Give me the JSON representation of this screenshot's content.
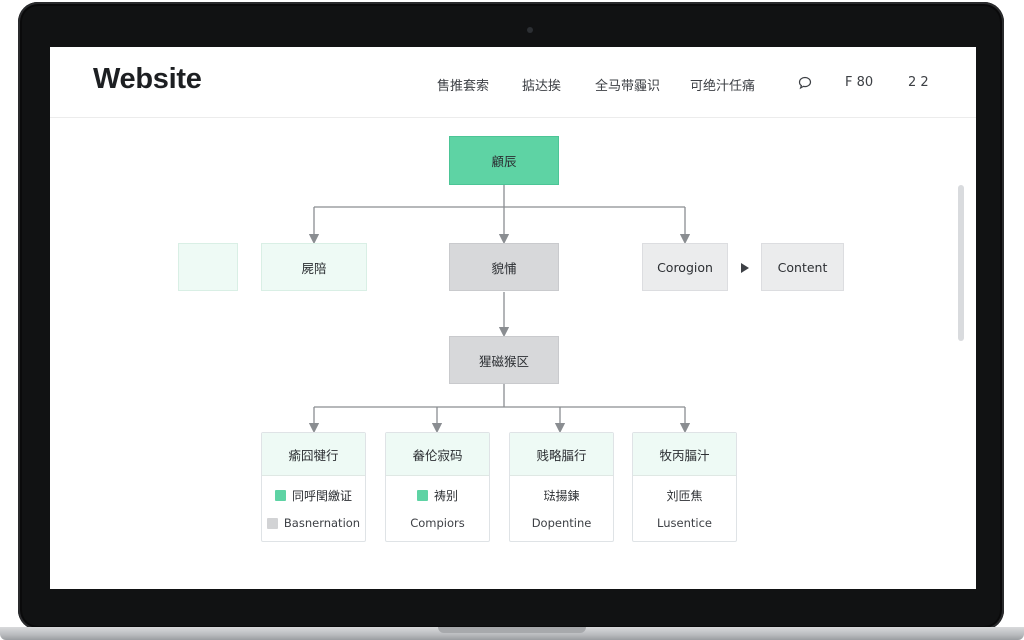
{
  "header": {
    "brand": "Website",
    "nav": [
      "售推套索",
      "掂达挨",
      "全马带霾识",
      "可绝汁任痛"
    ],
    "chat_icon": "speech-bubble-icon",
    "right_a": "F  80",
    "right_b": "2  2"
  },
  "diagram": {
    "root": "顧辰",
    "level1": {
      "mint_blank": "",
      "left": "屍陪",
      "center": "貌悑",
      "right": "Corogion",
      "content": "Content",
      "arrow_icon": "play-arrow-icon"
    },
    "level2": "猩磁猴区",
    "cards": [
      {
        "title": "瘉囧犍行",
        "row1": "同呼閏繳证",
        "row1_swatch": "green",
        "row2": "Basnernation",
        "row2_swatch": "gray"
      },
      {
        "title": "畚伦寂码",
        "row1": "祷别",
        "row1_swatch": "green",
        "row2": "Compiors"
      },
      {
        "title": "贱略腷行",
        "row1": "琺揚鍊",
        "row2": "Dopentine"
      },
      {
        "title": "牧丙腷汁",
        "row1": "刘匝焦",
        "row2": "Lusentice"
      }
    ]
  },
  "colors": {
    "accent_green": "#5ed3a4",
    "node_gray": "#d7d8da",
    "mint": "#eefaf5",
    "connector": "#8a8d91"
  }
}
